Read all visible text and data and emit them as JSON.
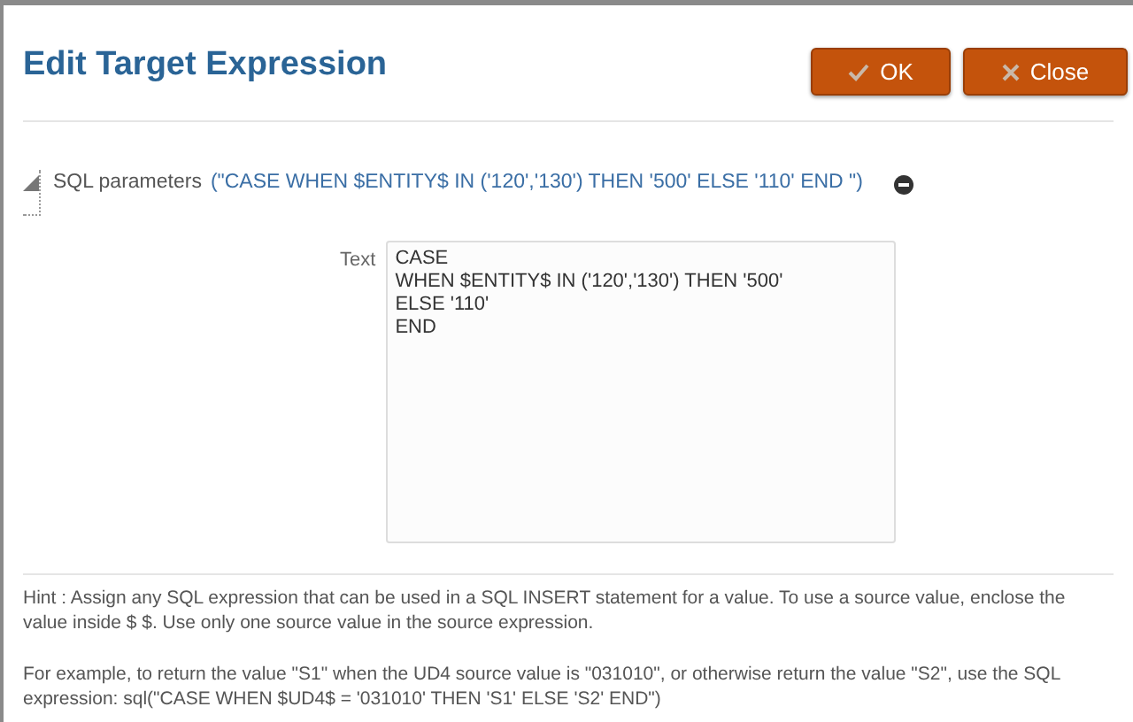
{
  "dialog": {
    "title": "Edit Target Expression"
  },
  "buttons": [
    {
      "label": "OK",
      "kind": "ok"
    },
    {
      "label": "Close",
      "kind": "close"
    }
  ],
  "parameter": {
    "name": "SQL parameters",
    "expanded": true,
    "expression": "(\"CASE WHEN $ENTITY$ IN ('120','130') THEN '500' ELSE '110' END \")"
  },
  "field": {
    "label": "Text",
    "value": "CASE\nWHEN $ENTITY$ IN ('120','130') THEN '500'\nELSE '110'\nEND"
  },
  "hints": [
    "Hint : Assign any SQL expression that can be used in a SQL INSERT statement for a value. To use a source value, enclose the value inside $ $. Use only one source value in the source expression.",
    "For example, to return the value \"S1\" when the UD4 source value is \"031010\", or otherwise return the value \"S2\", use the SQL expression: sql(\"CASE WHEN $UD4$ = '031010' THEN 'S1' ELSE 'S2' END\")"
  ]
}
